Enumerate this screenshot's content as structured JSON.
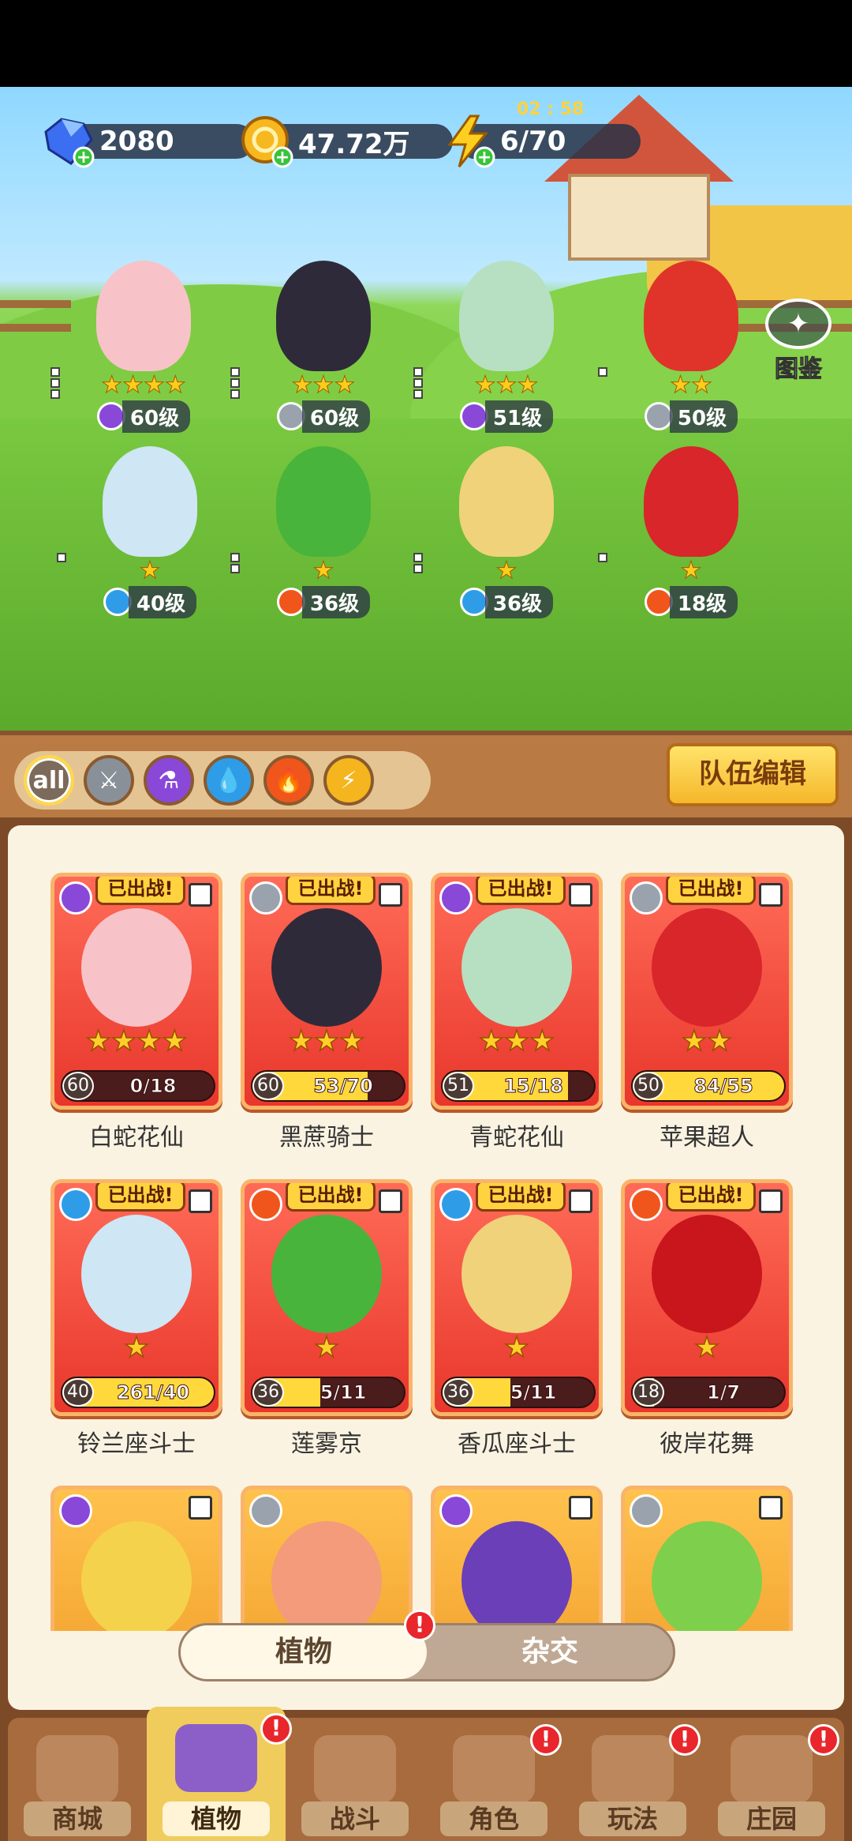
{
  "resources": {
    "gems": "2080",
    "coins": "47.72万",
    "energy": "6/70",
    "energy_timer": "02 : 58"
  },
  "codex_label": "图鉴",
  "team": [
    {
      "stars": "★★★★",
      "level": "60级",
      "element": "purple"
    },
    {
      "stars": "★★★",
      "level": "60级",
      "element": "sword"
    },
    {
      "stars": "★★★",
      "level": "51级",
      "element": "purple"
    },
    {
      "stars": "★★",
      "level": "50级",
      "element": "sword"
    },
    {
      "stars": "★",
      "level": "40级",
      "element": "water"
    },
    {
      "stars": "★",
      "level": "36级",
      "element": "fire"
    },
    {
      "stars": "★",
      "level": "36级",
      "element": "water"
    },
    {
      "stars": "★",
      "level": "18级",
      "element": "fire"
    }
  ],
  "filters": {
    "all_label": "all"
  },
  "team_edit_label": "队伍编辑",
  "cards": [
    {
      "name": "白蛇花仙",
      "deployed": "已出战!",
      "stars": "★★★★",
      "level": "60",
      "progress": "0/18",
      "fill": 0.0,
      "element": "purple"
    },
    {
      "name": "黑蔗骑士",
      "deployed": "已出战!",
      "stars": "★★★",
      "level": "60",
      "progress": "53/70",
      "fill": 0.76,
      "element": "sword"
    },
    {
      "name": "青蛇花仙",
      "deployed": "已出战!",
      "stars": "★★★",
      "level": "51",
      "progress": "15/18",
      "fill": 0.83,
      "element": "purple"
    },
    {
      "name": "苹果超人",
      "deployed": "已出战!",
      "stars": "★★",
      "level": "50",
      "progress": "84/55",
      "fill": 1.0,
      "element": "sword"
    },
    {
      "name": "铃兰座斗士",
      "deployed": "已出战!",
      "stars": "★",
      "level": "40",
      "progress": "261/40",
      "fill": 1.0,
      "element": "water"
    },
    {
      "name": "莲雾京",
      "deployed": "已出战!",
      "stars": "★",
      "level": "36",
      "progress": "5/11",
      "fill": 0.45,
      "element": "fire"
    },
    {
      "name": "香瓜座斗士",
      "deployed": "已出战!",
      "stars": "★",
      "level": "36",
      "progress": "5/11",
      "fill": 0.45,
      "element": "water"
    },
    {
      "name": "彼岸花舞",
      "deployed": "已出战!",
      "stars": "★",
      "level": "18",
      "progress": "1/7",
      "fill": 0.14,
      "element": "fire"
    }
  ],
  "toggle": {
    "plants": "植物",
    "hybrid": "杂交",
    "badge": "!"
  },
  "nav": [
    {
      "label": "商城",
      "badge": ""
    },
    {
      "label": "植物",
      "badge": "!"
    },
    {
      "label": "战斗",
      "badge": ""
    },
    {
      "label": "角色",
      "badge": "!"
    },
    {
      "label": "玩法",
      "badge": "!"
    },
    {
      "label": "庄园",
      "badge": "!"
    }
  ],
  "colors": {
    "purple": "#8a48d8",
    "sword": "#9aa3ad",
    "water": "#2f9ce8",
    "fire": "#f0561c",
    "lightning": "#f5b51e"
  }
}
